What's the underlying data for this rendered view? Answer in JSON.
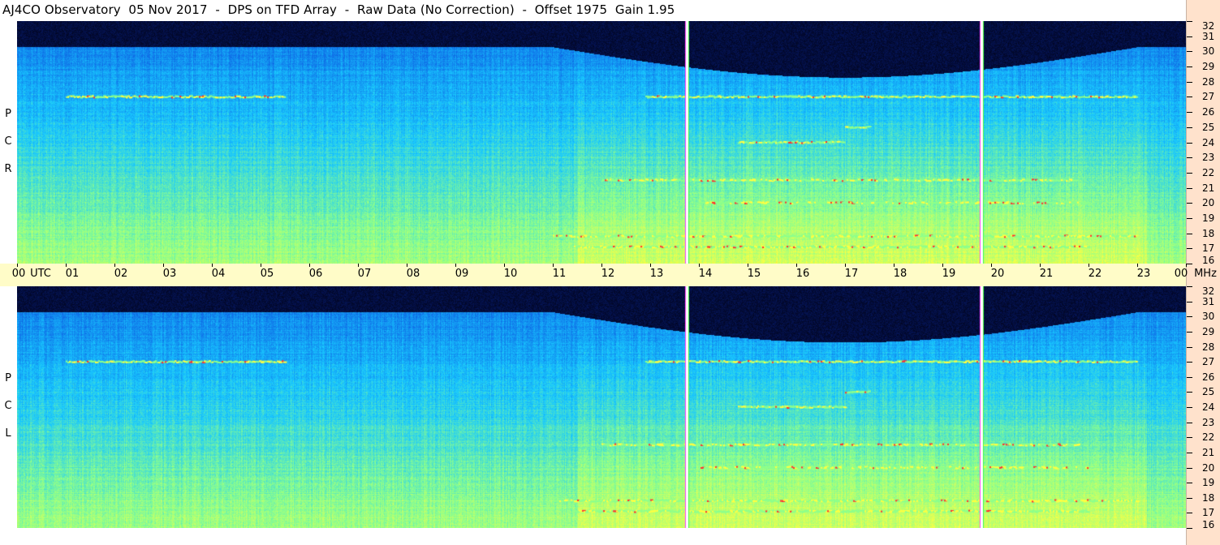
{
  "title": "AJ4CO Observatory  05 Nov 2017  -  DPS on TFD Array  -  Raw Data (No Correction)  -  Offset 1975  Gain 1.95",
  "polarizations": [
    {
      "id": "rcp",
      "letters": [
        "P",
        "C",
        "R"
      ]
    },
    {
      "id": "lcp",
      "letters": [
        "P",
        "C",
        "L"
      ]
    }
  ],
  "chart_data": {
    "type": "heatmap",
    "title": "AJ4CO Observatory  05 Nov 2017  -  DPS on TFD Array  -  Raw Data (No Correction)  -  Offset 1975  Gain 1.95",
    "x_axis": {
      "label": "UTC",
      "range": [
        0,
        24
      ],
      "ticks": [
        "00",
        "01",
        "02",
        "03",
        "04",
        "05",
        "06",
        "07",
        "08",
        "09",
        "10",
        "11",
        "12",
        "13",
        "14",
        "15",
        "16",
        "17",
        "18",
        "19",
        "20",
        "21",
        "22",
        "23",
        "00"
      ]
    },
    "y_axis": {
      "unit": "MHz",
      "range": [
        16,
        32
      ],
      "ticks": [
        "32",
        "31",
        "30",
        "29",
        "28",
        "27",
        "26",
        "25",
        "24",
        "23",
        "22",
        "21",
        "20",
        "19",
        "18",
        "17",
        "16"
      ]
    },
    "panels": [
      "RCP",
      "LCP"
    ],
    "colormap": [
      "#000010",
      "#0a2aa0",
      "#0f6be6",
      "#18c8ff",
      "#8cff8c",
      "#ffff40",
      "#ff3030",
      "#ff40ff"
    ],
    "vertical_markers_utc": [
      13.75,
      19.8
    ],
    "features": [
      {
        "freq_mhz": 27.0,
        "utc": [
          1.0,
          5.5
        ],
        "note": "band"
      },
      {
        "freq_mhz": 27.0,
        "utc": [
          12.9,
          23.0
        ],
        "note": "band"
      },
      {
        "freq_mhz": 21.5,
        "utc": [
          12.0,
          21.8
        ],
        "note": "band"
      },
      {
        "freq_mhz": 20.0,
        "utc": [
          14.0,
          22.0
        ],
        "note": "band"
      },
      {
        "freq_mhz": 17.8,
        "utc": [
          11.0,
          23.0
        ],
        "note": "band"
      },
      {
        "freq_mhz": 17.1,
        "utc": [
          11.4,
          22.0
        ],
        "note": "band"
      },
      {
        "freq_mhz": 24.0,
        "utc": [
          14.8,
          17.0
        ],
        "note": "band"
      },
      {
        "freq_mhz": 25.0,
        "utc": [
          17.0,
          17.5
        ],
        "note": "band"
      }
    ]
  }
}
